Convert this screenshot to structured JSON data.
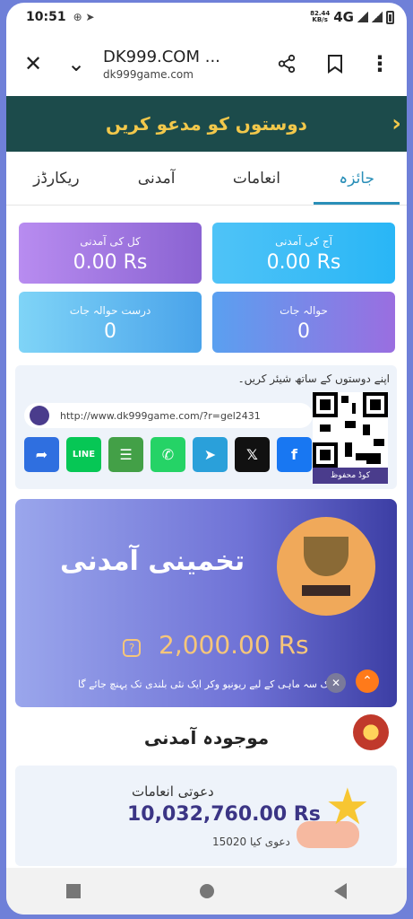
{
  "status_bar": {
    "time": "10:51",
    "net_speed_top": "82.44",
    "net_speed_bottom": "KB/s",
    "network": "4G"
  },
  "browser": {
    "title": "DK999.COM ...",
    "url": "dk999game.com"
  },
  "banner": {
    "text": "دوستوں کو مدعو کریں"
  },
  "tabs": [
    {
      "label": "جائزہ",
      "active": true
    },
    {
      "label": "انعامات",
      "active": false
    },
    {
      "label": "آمدنی",
      "active": false
    },
    {
      "label": "ریکارڈز",
      "active": false
    }
  ],
  "stats": {
    "today_income": {
      "label": "آج کی آمدنی",
      "value": "0.00 Rs"
    },
    "total_income": {
      "label": "کل کی آمدنی",
      "value": "0.00 Rs"
    },
    "referrals": {
      "label": "حوالہ جات",
      "value": "0"
    },
    "valid_referrals": {
      "label": "درست حوالہ جات",
      "value": "0"
    }
  },
  "share": {
    "heading": "اپنے دوستوں کے ساتھ شیئر کریں۔",
    "link": "http://www.dk999game.com/?r=gel2431",
    "qr_label": "کوڈ محفوظ",
    "socials": [
      "share",
      "line",
      "sms",
      "whatsapp",
      "telegram",
      "x",
      "facebook"
    ]
  },
  "promo": {
    "title": "تخمینی آمدنی",
    "amount": "2,000.00 Rs",
    "note": "ایک سہ ماہی کے لیے ریونیو وکر ایک نئی بلندی تک پہنچ جائے گا"
  },
  "current_income": {
    "title": "موجودہ آمدنی"
  },
  "reward": {
    "label": "دعوتی انعامات",
    "amount": "10,032,760.00 Rs",
    "count": "15020 دعوی کیا"
  },
  "colors": {
    "banner_bg": "#1c4b4b",
    "banner_text": "#f2c84b",
    "accent": "#2a8fb8",
    "reward_text": "#3b3585"
  }
}
